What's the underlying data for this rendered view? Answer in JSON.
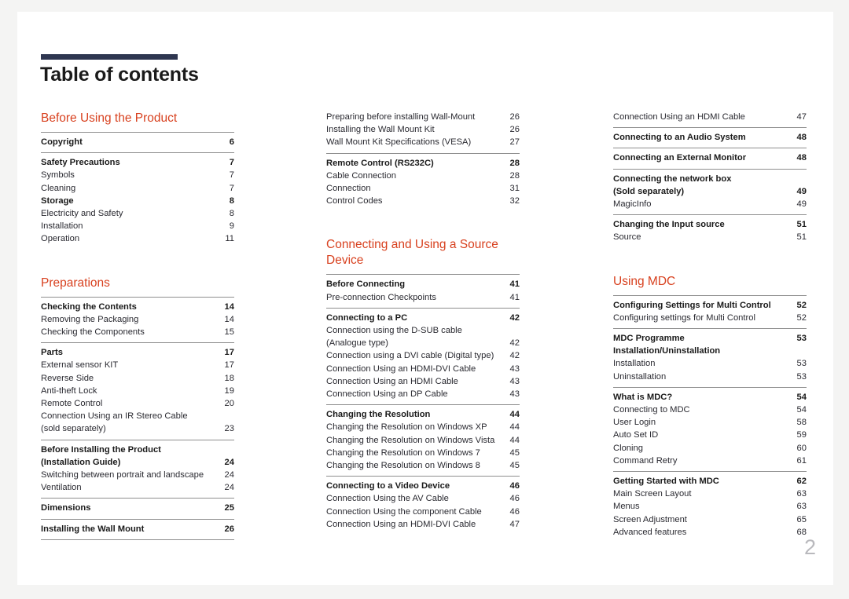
{
  "document": {
    "title": "Table of contents",
    "page_number": "2",
    "accent_color": "#d8411f",
    "rule_color": "#2e3650"
  },
  "columns": [
    {
      "id": "column-1",
      "blocks": [
        {
          "type": "section",
          "heading": "Before Using the Product",
          "groups": [
            {
              "entries": [
                {
                  "label": "Copyright",
                  "page": "6",
                  "bold": true
                }
              ]
            },
            {
              "entries": [
                {
                  "label": "Safety Precautions",
                  "page": "7",
                  "bold": true
                },
                {
                  "label": "Symbols",
                  "page": "7",
                  "bold": false
                },
                {
                  "label": "Cleaning",
                  "page": "7",
                  "bold": false
                },
                {
                  "label": "Storage",
                  "page": "8",
                  "bold": true
                },
                {
                  "label": "Electricity and Safety",
                  "page": "8",
                  "bold": false
                },
                {
                  "label": "Installation",
                  "page": "9",
                  "bold": false
                },
                {
                  "label": "Operation",
                  "page": "11",
                  "bold": false
                }
              ]
            }
          ]
        },
        {
          "type": "section",
          "heading": "Preparations",
          "groups": [
            {
              "entries": [
                {
                  "label": "Checking the Contents",
                  "page": "14",
                  "bold": true
                },
                {
                  "label": "Removing the Packaging",
                  "page": "14",
                  "bold": false
                },
                {
                  "label": "Checking the Components",
                  "page": "15",
                  "bold": false
                }
              ]
            },
            {
              "entries": [
                {
                  "label": "Parts",
                  "page": "17",
                  "bold": true
                },
                {
                  "label": "External sensor KIT",
                  "page": "17",
                  "bold": false
                },
                {
                  "label": "Reverse Side",
                  "page": "18",
                  "bold": false
                },
                {
                  "label": "Anti-theft Lock",
                  "page": "19",
                  "bold": false
                },
                {
                  "label": "Remote Control",
                  "page": "20",
                  "bold": false
                },
                {
                  "label": "Connection Using an IR Stereo Cable",
                  "page": "",
                  "bold": false
                },
                {
                  "label": "(sold separately)",
                  "page": "23",
                  "bold": false
                }
              ]
            },
            {
              "entries": [
                {
                  "label": "Before Installing the Product",
                  "page": "",
                  "bold": true
                },
                {
                  "label": "(Installation Guide)",
                  "page": "24",
                  "bold": true
                },
                {
                  "label": "Switching between portrait and landscape",
                  "page": "24",
                  "bold": false
                },
                {
                  "label": "Ventilation",
                  "page": "24",
                  "bold": false
                }
              ]
            },
            {
              "entries": [
                {
                  "label": "Dimensions",
                  "page": "25",
                  "bold": true
                }
              ]
            },
            {
              "entries": [
                {
                  "label": "Installing the Wall Mount",
                  "page": "26",
                  "bold": true
                }
              ],
              "closing_rule": true
            }
          ]
        }
      ]
    },
    {
      "id": "column-2",
      "blocks": [
        {
          "type": "continuation",
          "heading": "",
          "groups": [
            {
              "no_rule": true,
              "entries": [
                {
                  "label": "Preparing before installing Wall-Mount",
                  "page": "26",
                  "bold": false
                },
                {
                  "label": "Installing the Wall Mount Kit",
                  "page": "26",
                  "bold": false
                },
                {
                  "label": "Wall Mount Kit Specifications (VESA)",
                  "page": "27",
                  "bold": false
                }
              ]
            },
            {
              "entries": [
                {
                  "label": "Remote Control (RS232C)",
                  "page": "28",
                  "bold": true
                },
                {
                  "label": "Cable Connection",
                  "page": "28",
                  "bold": false
                },
                {
                  "label": "Connection",
                  "page": "31",
                  "bold": false
                },
                {
                  "label": "Control Codes",
                  "page": "32",
                  "bold": false
                }
              ]
            }
          ]
        },
        {
          "type": "section",
          "heading": "Connecting and Using a Source\nDevice",
          "groups": [
            {
              "entries": [
                {
                  "label": "Before Connecting",
                  "page": "41",
                  "bold": true
                },
                {
                  "label": "Pre-connection Checkpoints",
                  "page": "41",
                  "bold": false
                }
              ]
            },
            {
              "entries": [
                {
                  "label": "Connecting to a PC",
                  "page": "42",
                  "bold": true
                },
                {
                  "label": "Connection using the D-SUB cable",
                  "page": "",
                  "bold": false
                },
                {
                  "label": "(Analogue type)",
                  "page": "42",
                  "bold": false
                },
                {
                  "label": "Connection using a DVI cable (Digital type)",
                  "page": "42",
                  "bold": false
                },
                {
                  "label": "Connection Using an HDMI-DVI Cable",
                  "page": "43",
                  "bold": false
                },
                {
                  "label": "Connection Using an HDMI Cable",
                  "page": "43",
                  "bold": false
                },
                {
                  "label": "Connection Using an DP Cable",
                  "page": "43",
                  "bold": false
                }
              ]
            },
            {
              "entries": [
                {
                  "label": "Changing the Resolution",
                  "page": "44",
                  "bold": true
                },
                {
                  "label": "Changing the Resolution on Windows XP",
                  "page": "44",
                  "bold": false
                },
                {
                  "label": "Changing the Resolution on Windows Vista",
                  "page": "44",
                  "bold": false
                },
                {
                  "label": "Changing the Resolution on Windows 7",
                  "page": "45",
                  "bold": false
                },
                {
                  "label": "Changing the Resolution on Windows 8",
                  "page": "45",
                  "bold": false
                }
              ]
            },
            {
              "entries": [
                {
                  "label": "Connecting to a Video Device",
                  "page": "46",
                  "bold": true
                },
                {
                  "label": "Connection Using the AV Cable",
                  "page": "46",
                  "bold": false
                },
                {
                  "label": "Connection Using the component Cable",
                  "page": "46",
                  "bold": false
                },
                {
                  "label": "Connection Using an HDMI-DVI Cable",
                  "page": "47",
                  "bold": false
                }
              ]
            }
          ]
        }
      ]
    },
    {
      "id": "column-3",
      "blocks": [
        {
          "type": "continuation",
          "heading": "",
          "groups": [
            {
              "no_rule": true,
              "entries": [
                {
                  "label": "Connection Using an HDMI Cable",
                  "page": "47",
                  "bold": false
                }
              ]
            },
            {
              "entries": [
                {
                  "label": "Connecting to an Audio System",
                  "page": "48",
                  "bold": true
                }
              ]
            },
            {
              "entries": [
                {
                  "label": "Connecting an External Monitor",
                  "page": "48",
                  "bold": true
                }
              ]
            },
            {
              "entries": [
                {
                  "label": "Connecting the network box",
                  "page": "",
                  "bold": true
                },
                {
                  "label": "(Sold separately)",
                  "page": "49",
                  "bold": true
                },
                {
                  "label": "MagicInfo",
                  "page": "49",
                  "bold": false
                }
              ]
            },
            {
              "entries": [
                {
                  "label": "Changing the Input source",
                  "page": "51",
                  "bold": true
                },
                {
                  "label": "Source",
                  "page": "51",
                  "bold": false
                }
              ]
            }
          ]
        },
        {
          "type": "section",
          "heading": "Using MDC",
          "groups": [
            {
              "entries": [
                {
                  "label": "Configuring Settings for Multi Control",
                  "page": "52",
                  "bold": true
                },
                {
                  "label": "Configuring settings for Multi Control",
                  "page": "52",
                  "bold": false
                }
              ]
            },
            {
              "entries": [
                {
                  "label": "MDC Programme Installation/Uninstallation",
                  "page": "53",
                  "bold": true
                },
                {
                  "label": "Installation",
                  "page": "53",
                  "bold": false
                },
                {
                  "label": "Uninstallation",
                  "page": "53",
                  "bold": false
                }
              ]
            },
            {
              "entries": [
                {
                  "label": "What is MDC?",
                  "page": "54",
                  "bold": true
                },
                {
                  "label": "Connecting to MDC",
                  "page": "54",
                  "bold": false
                },
                {
                  "label": "User Login",
                  "page": "58",
                  "bold": false
                },
                {
                  "label": "Auto Set ID",
                  "page": "59",
                  "bold": false
                },
                {
                  "label": "Cloning",
                  "page": "60",
                  "bold": false
                },
                {
                  "label": "Command Retry",
                  "page": "61",
                  "bold": false
                }
              ]
            },
            {
              "entries": [
                {
                  "label": "Getting Started with MDC",
                  "page": "62",
                  "bold": true
                },
                {
                  "label": "Main Screen Layout",
                  "page": "63",
                  "bold": false
                },
                {
                  "label": "Menus",
                  "page": "63",
                  "bold": false
                },
                {
                  "label": "Screen Adjustment",
                  "page": "65",
                  "bold": false
                },
                {
                  "label": "Advanced features",
                  "page": "68",
                  "bold": false
                }
              ]
            }
          ]
        }
      ]
    }
  ]
}
